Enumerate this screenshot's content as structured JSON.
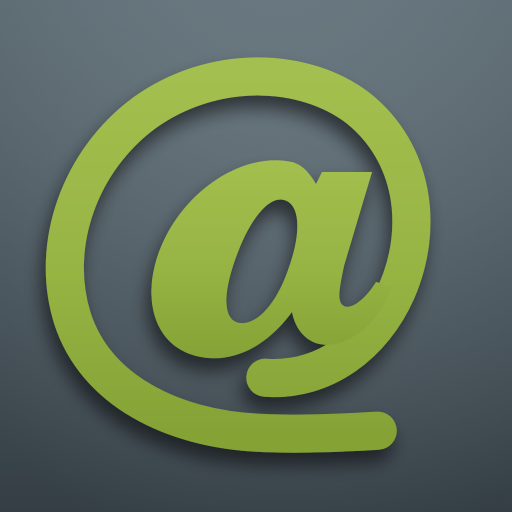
{
  "icon": {
    "name": "at-sign-icon",
    "glyph": "@"
  },
  "colors": {
    "background_top": "#66767f",
    "background_bottom": "#3c474f",
    "symbol_light": "#a3bf4f",
    "symbol_mid": "#96b443",
    "symbol_dark": "#85a236",
    "shadow": "#1c2329"
  }
}
